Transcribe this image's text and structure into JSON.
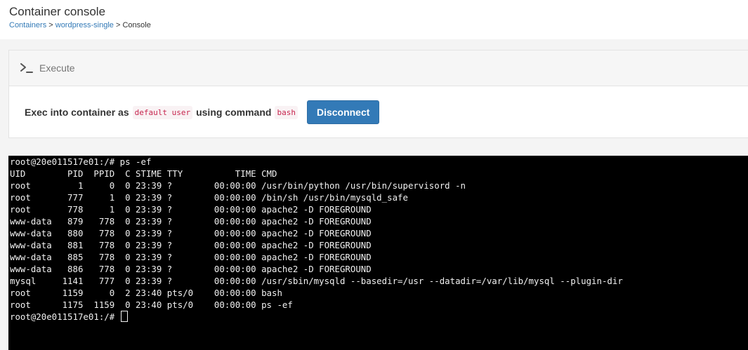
{
  "header": {
    "title": "Container console",
    "breadcrumb": {
      "containers": "Containers",
      "sep1": " > ",
      "container": "wordpress-single",
      "sep2": " > ",
      "current": "Console"
    }
  },
  "panel": {
    "title": "Execute",
    "icon": "terminal-icon",
    "exec_prefix": "Exec into container as",
    "user_chip": "default user",
    "exec_middle": "using command",
    "command_chip": "bash",
    "disconnect_label": "Disconnect",
    "accent_color": "#337ab7"
  },
  "terminal": {
    "lines": [
      "root@20e011517e01:/# ps -ef",
      "UID        PID  PPID  C STIME TTY          TIME CMD",
      "root         1     0  0 23:39 ?        00:00:00 /usr/bin/python /usr/bin/supervisord -n",
      "root       777     1  0 23:39 ?        00:00:00 /bin/sh /usr/bin/mysqld_safe",
      "root       778     1  0 23:39 ?        00:00:00 apache2 -D FOREGROUND",
      "www-data   879   778  0 23:39 ?        00:00:00 apache2 -D FOREGROUND",
      "www-data   880   778  0 23:39 ?        00:00:00 apache2 -D FOREGROUND",
      "www-data   881   778  0 23:39 ?        00:00:00 apache2 -D FOREGROUND",
      "www-data   885   778  0 23:39 ?        00:00:00 apache2 -D FOREGROUND",
      "www-data   886   778  0 23:39 ?        00:00:00 apache2 -D FOREGROUND",
      "mysql     1141   777  0 23:39 ?        00:00:00 /usr/sbin/mysqld --basedir=/usr --datadir=/var/lib/mysql --plugin-dir",
      "root      1159     0  2 23:40 pts/0    00:00:00 bash",
      "root      1175  1159  0 23:40 pts/0    00:00:00 ps -ef"
    ],
    "prompt": "root@20e011517e01:/# ",
    "background": "#000000",
    "foreground": "#f0f0f0"
  }
}
